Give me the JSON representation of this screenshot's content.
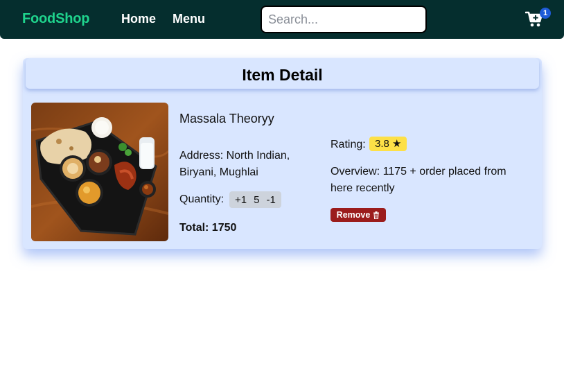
{
  "navbar": {
    "brand": "FoodShop",
    "links": [
      "Home",
      "Menu"
    ],
    "search_placeholder": "Search...",
    "cart_icon": "cart-plus-icon",
    "cart_count": "1"
  },
  "detail": {
    "title": "Item Detail",
    "image_icon": "food-thali-image",
    "name": "Massala Theoryy",
    "address": "Address: North Indian, Biryani, Mughlai",
    "quantity_label": "Quantity:",
    "increment_label": "+1",
    "quantity_value": "5",
    "decrement_label": "-1",
    "total": "Total: 1750",
    "rating_label": "Rating:",
    "rating_badge": "3.8 ★",
    "overview": "Overview: 1175 + order placed from here recently",
    "remove_label": "Remove",
    "remove_icon": "trash-icon"
  },
  "colors": {
    "navbar_bg": "#052e2e",
    "brand": "#1fd48d",
    "card_bg": "#d9e6ff",
    "rating_badge": "#fde047",
    "remove_button": "#9b1c1c",
    "cart_badge": "#1e5bd8"
  }
}
